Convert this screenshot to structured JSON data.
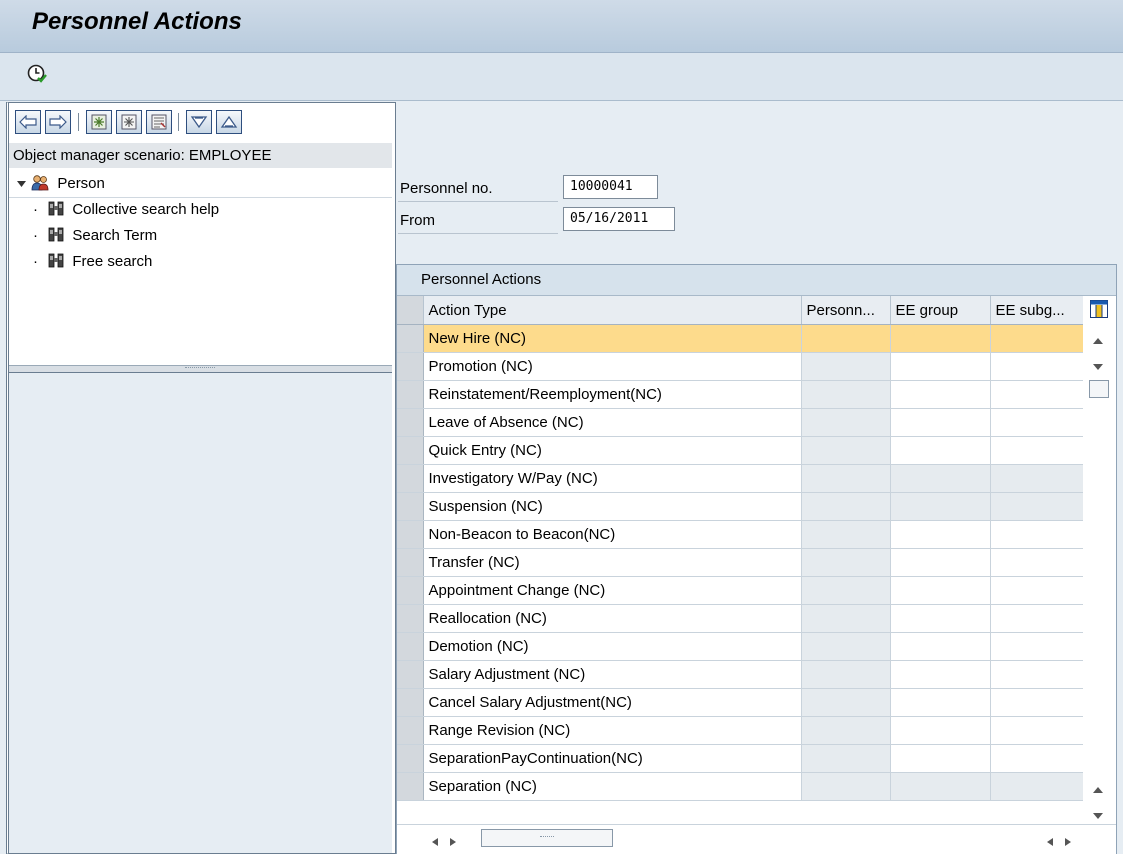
{
  "title": "Personnel Actions",
  "toolbar": {
    "execute_icon": "execute-clock-icon"
  },
  "nav": {
    "buttons": [
      "back-arrow-icon",
      "forward-arrow-icon",
      "new-node-icon",
      "select-all-icon",
      "hitlist-icon",
      "expand-down-icon",
      "collapse-up-icon"
    ]
  },
  "scenario": "Object manager scenario: EMPLOYEE",
  "tree": {
    "root": "Person",
    "children": [
      "Collective search help",
      "Search Term",
      "Free search"
    ]
  },
  "fields": {
    "personnel_no_label": "Personnel no.",
    "personnel_no_value": "10000041",
    "from_label": "From",
    "from_value": "05/16/2011"
  },
  "table": {
    "title": "Personnel Actions",
    "columns": [
      "Action Type",
      "Personn...",
      "EE group",
      "EE subg..."
    ],
    "rows": [
      "New Hire (NC)",
      "Promotion (NC)",
      "Reinstatement/Reemployment(NC)",
      "Leave of Absence (NC)",
      "Quick Entry (NC)",
      "Investigatory W/Pay (NC)",
      "Suspension (NC)",
      "Non-Beacon to Beacon(NC)",
      "Transfer (NC)",
      "Appointment Change (NC)",
      "Reallocation (NC)",
      "Demotion (NC)",
      "Salary Adjustment (NC)",
      "Cancel Salary Adjustment(NC)",
      "Range Revision (NC)",
      "SeparationPayContinuation(NC)",
      "Separation (NC)"
    ],
    "selected_row": 0,
    "grey_rows": [
      0,
      5,
      6,
      16
    ]
  },
  "colors": {
    "highlight": "#fddb8c",
    "header_bg": "#d6e2ec",
    "title_bar": "#c4d4e4"
  }
}
